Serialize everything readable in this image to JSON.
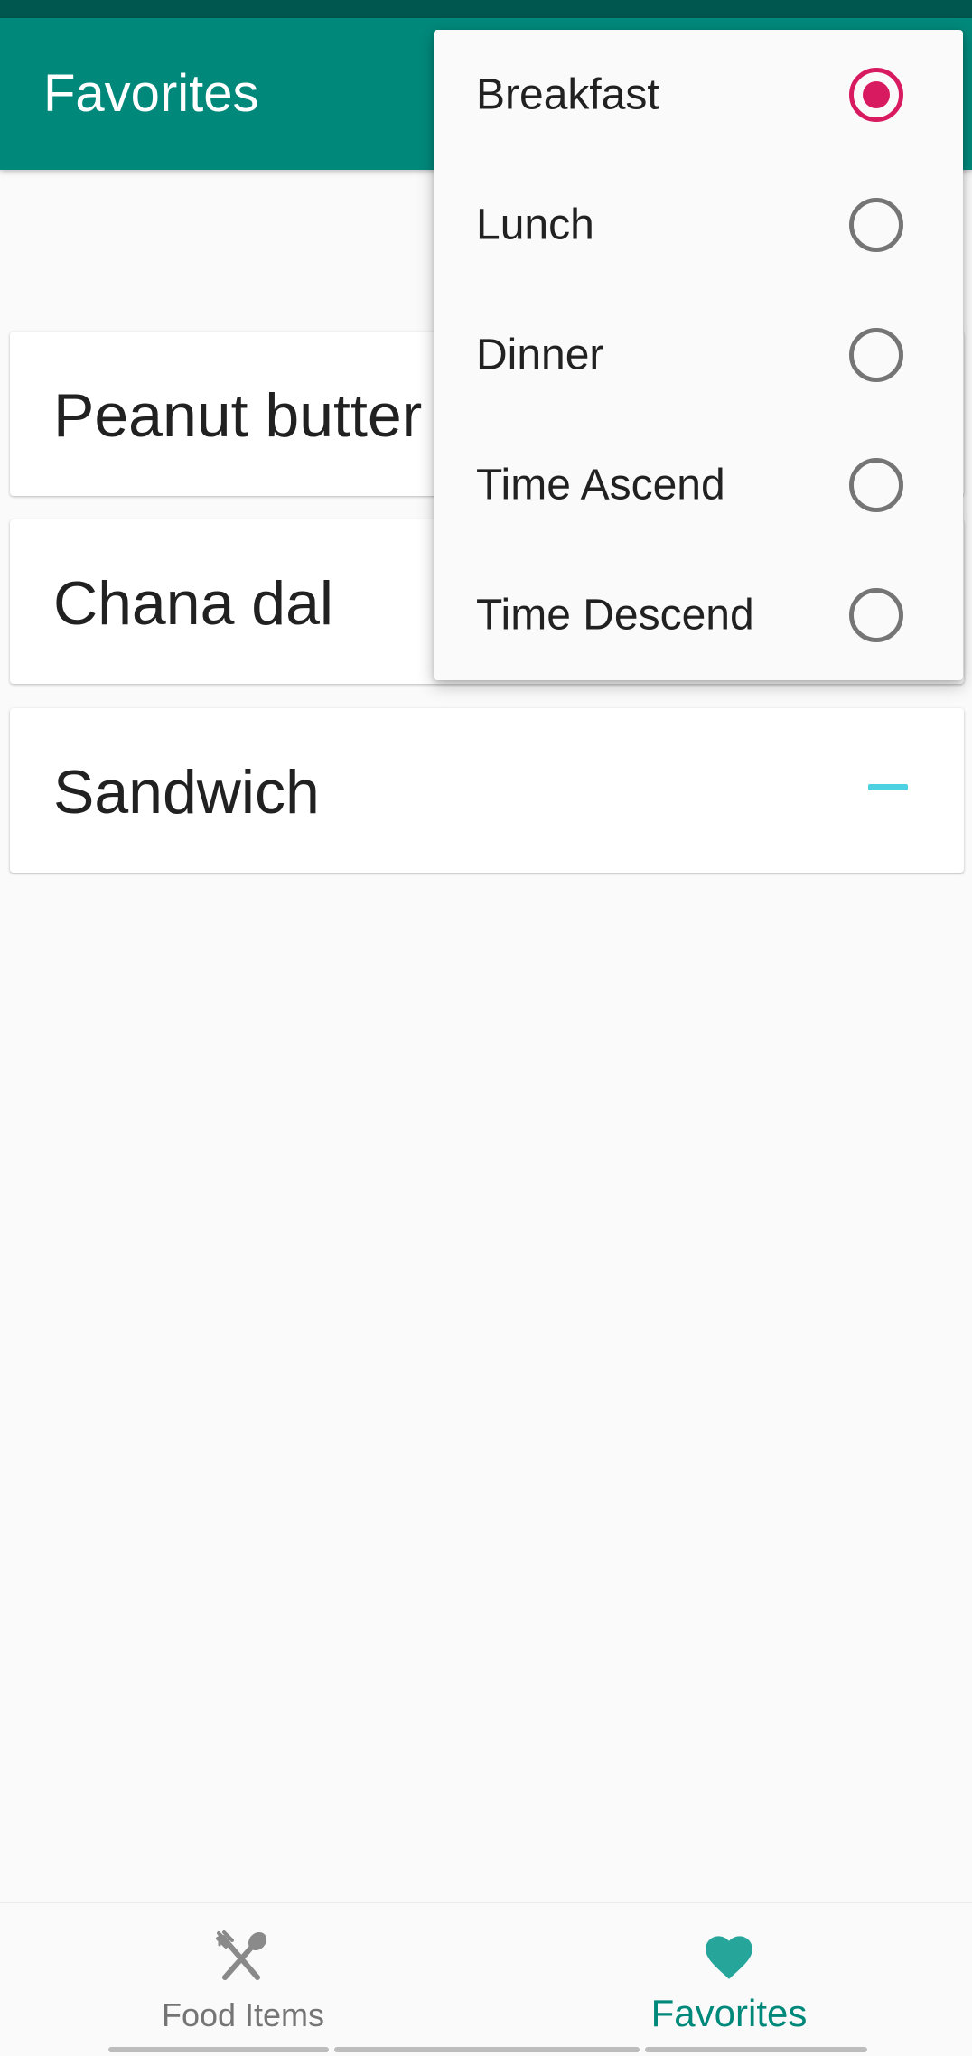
{
  "app_bar": {
    "title": "Favorites"
  },
  "favorites": [
    {
      "name": "Peanut butter"
    },
    {
      "name": "Chana dal"
    },
    {
      "name": "Sandwich"
    }
  ],
  "sort_menu": {
    "selected": "Breakfast",
    "items": [
      {
        "label": "Breakfast",
        "checked": true
      },
      {
        "label": "Lunch",
        "checked": false
      },
      {
        "label": "Dinner",
        "checked": false
      },
      {
        "label": "Time Ascend",
        "checked": false
      },
      {
        "label": "Time Descend",
        "checked": false
      }
    ]
  },
  "bottom_nav": {
    "items": [
      {
        "label": "Food Items",
        "icon": "fork-spoon-icon",
        "active": false
      },
      {
        "label": "Favorites",
        "icon": "heart-icon",
        "active": true
      }
    ]
  },
  "colors": {
    "primary": "#00897b",
    "primary_dark": "#00574f",
    "accent": "#d81b60",
    "remove_indicator": "#4dd0e1"
  }
}
